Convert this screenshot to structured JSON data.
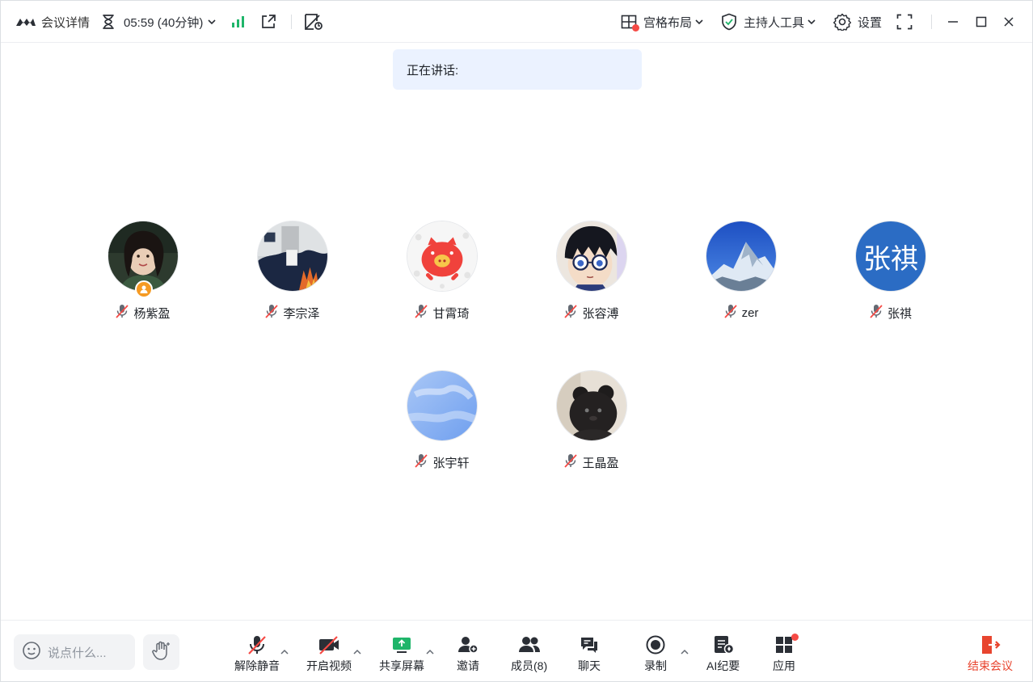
{
  "topbar": {
    "meeting_details": "会议详情",
    "timer": "05:59 (40分钟)",
    "layout": "宫格布局",
    "host_tools": "主持人工具",
    "settings": "设置"
  },
  "speaking": {
    "label": "正在讲话:"
  },
  "participants": [
    {
      "name": "杨紫盈",
      "avatar": "photo",
      "host": true,
      "muted": true
    },
    {
      "name": "李宗泽",
      "avatar": "photo",
      "host": false,
      "muted": true
    },
    {
      "name": "甘霄琦",
      "avatar": "pig-cartoon",
      "host": false,
      "muted": true
    },
    {
      "name": "张容溥",
      "avatar": "anime-boy",
      "host": false,
      "muted": true
    },
    {
      "name": "zer",
      "avatar": "mountain",
      "host": false,
      "muted": true
    },
    {
      "name": "张祺",
      "avatar": "text",
      "avatar_text": "张祺",
      "avatar_color": "#2b6cc4",
      "host": false,
      "muted": true
    },
    {
      "name": "张宇轩",
      "avatar": "sky",
      "host": false,
      "muted": true
    },
    {
      "name": "王晶盈",
      "avatar": "plush-bear",
      "host": false,
      "muted": true
    }
  ],
  "bottombar": {
    "chat_placeholder": "说点什么...",
    "unmute": "解除静音",
    "start_video": "开启视频",
    "share_screen": "共享屏幕",
    "invite": "邀请",
    "members": "成员(8)",
    "chat": "聊天",
    "record": "录制",
    "ai_summary": "AI纪要",
    "apps": "应用",
    "end_meeting": "结束会议"
  },
  "colors": {
    "accent_green": "#1fb56a",
    "alert_red": "#f54a45",
    "end_red": "#e8452f",
    "host_orange": "#f59a23",
    "speaking_bg": "#ebf2ff"
  }
}
